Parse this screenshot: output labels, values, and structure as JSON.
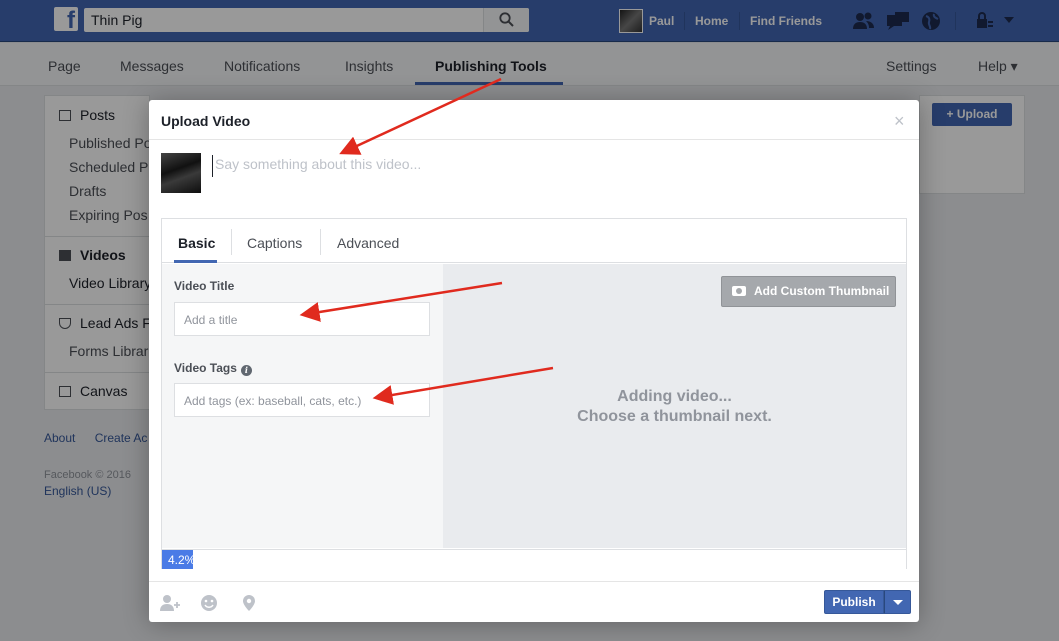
{
  "topbar": {
    "search_value": "Thin Pig",
    "user_name": "Paul",
    "home_label": "Home",
    "find_friends_label": "Find Friends"
  },
  "page_tabs": {
    "page": "Page",
    "messages": "Messages",
    "notifications": "Notifications",
    "insights": "Insights",
    "publishing_tools": "Publishing Tools",
    "settings": "Settings",
    "help": "Help ▾"
  },
  "sidebar": {
    "posts_header": "Posts",
    "published_posts": "Published Po",
    "scheduled_posts": "Scheduled Po",
    "drafts": "Drafts",
    "expiring_posts": "Expiring Pos",
    "videos_header": "Videos",
    "video_library": "Video Library",
    "lead_ads_header": "Lead Ads F",
    "forms_library": "Forms Librar",
    "canvas_header": "Canvas"
  },
  "footer": {
    "about": "About",
    "create_ad": "Create Ac",
    "copyright": "Facebook © 2016",
    "language": "English (US)"
  },
  "right": {
    "upload_label": "+ Upload"
  },
  "modal": {
    "title": "Upload Video",
    "close": "×",
    "compose_placeholder": "Say something about this video...",
    "tabs": {
      "basic": "Basic",
      "captions": "Captions",
      "advanced": "Advanced"
    },
    "video_title_label": "Video Title",
    "video_title_placeholder": "Add a title",
    "video_tags_label": "Video Tags",
    "video_tags_placeholder": "Add tags (ex: baseball, cats, etc.)",
    "add_custom_thumbnail": "Add Custom Thumbnail",
    "adding_line1": "Adding video...",
    "adding_line2": "Choose a thumbnail next.",
    "progress_text": "4.2%",
    "progress_fraction": 0.042,
    "publish_label": "Publish"
  },
  "colors": {
    "facebook_blue": "#4267b2",
    "annotation_arrow": "#e02a1e",
    "progress_blue": "#4a7be6"
  },
  "icons": [
    "search-icon",
    "friend-requests-icon",
    "messages-icon",
    "globe-icon",
    "privacy-lock-icon",
    "chevron-down-icon",
    "camera-icon",
    "info-icon",
    "tag-people-icon",
    "feeling-emoji-icon",
    "location-pin-icon",
    "close-icon"
  ]
}
